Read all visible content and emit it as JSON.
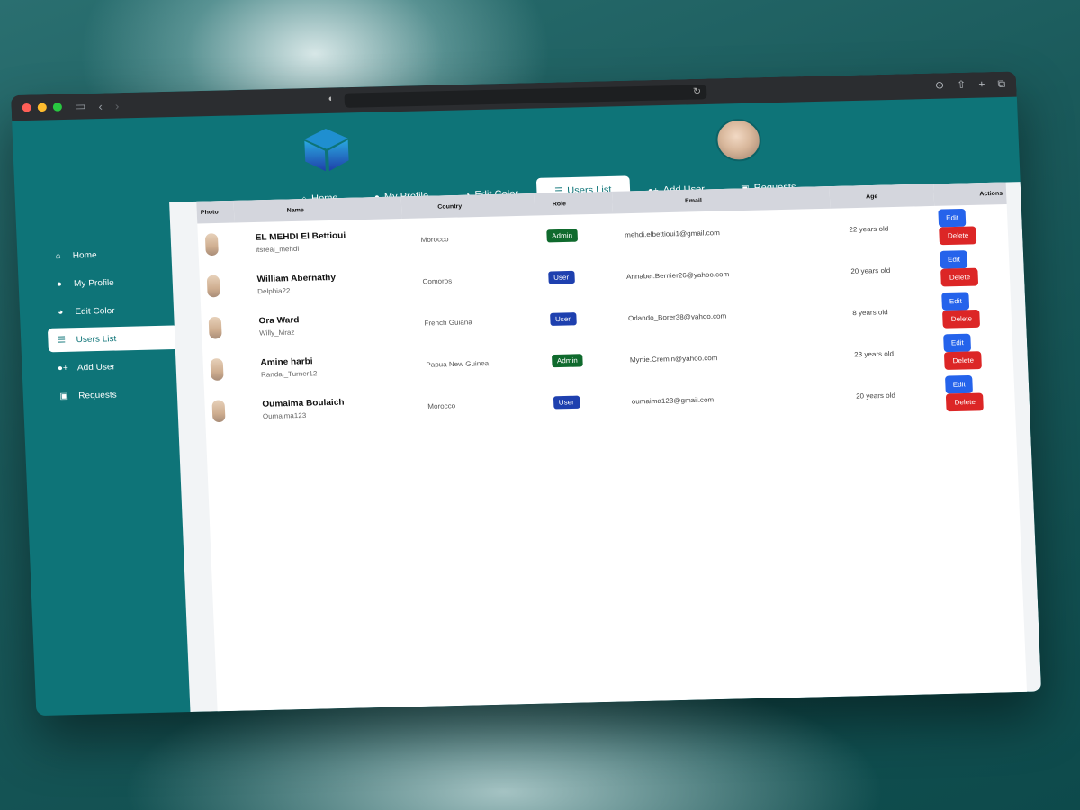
{
  "browser": {
    "icons": [
      "sidebar-toggle-icon",
      "back-icon",
      "forward-icon",
      "shield-icon",
      "reload-icon",
      "download-icon",
      "share-icon",
      "new-tab-icon",
      "tabs-icon"
    ]
  },
  "topnav": [
    {
      "label": "Home",
      "icon": "home-icon"
    },
    {
      "label": "My Profile",
      "icon": "user-icon"
    },
    {
      "label": "Edit Color",
      "icon": "palette-icon"
    },
    {
      "label": "Users List",
      "icon": "list-icon",
      "active": true
    },
    {
      "label": "Add User",
      "icon": "user-plus-icon"
    },
    {
      "label": "Requests",
      "icon": "badge-icon"
    }
  ],
  "sidebar": [
    {
      "label": "Home",
      "icon": "home-icon"
    },
    {
      "label": "My Profile",
      "icon": "user-icon"
    },
    {
      "label": "Edit Color",
      "icon": "palette-icon"
    },
    {
      "label": "Users List",
      "icon": "list-icon",
      "active": true
    },
    {
      "label": "Add User",
      "icon": "user-plus-icon"
    },
    {
      "label": "Requests",
      "icon": "badge-icon"
    }
  ],
  "table": {
    "headers": [
      "Photo",
      "Name",
      "Country",
      "Role",
      "Email",
      "Age",
      "Actions"
    ],
    "rows": [
      {
        "name": "EL MEHDI El Bettioui",
        "username": "itsreal_mehdi",
        "country": "Morocco",
        "role": "Admin",
        "email": "mehdi.elbettioui1@gmail.com",
        "age": "22 years old"
      },
      {
        "name": "William Abernathy",
        "username": "Delphia22",
        "country": "Comoros",
        "role": "User",
        "email": "Annabel.Bernier26@yahoo.com",
        "age": "20 years old"
      },
      {
        "name": "Ora Ward",
        "username": "Willy_Mraz",
        "country": "French Guiana",
        "role": "User",
        "email": "Orlando_Borer38@yahoo.com",
        "age": "8 years old"
      },
      {
        "name": "Amine harbi",
        "username": "Randal_Turner12",
        "country": "Papua New Guinea",
        "role": "Admin",
        "email": "Myrtie.Cremin@yahoo.com",
        "age": "23 years old"
      },
      {
        "name": "Oumaima Boulaich",
        "username": "Oumaima123",
        "country": "Morocco",
        "role": "User",
        "email": "oumaima123@gmail.com",
        "age": "20 years old"
      }
    ],
    "edit_label": "Edit",
    "delete_label": "Delete"
  },
  "colors": {
    "primary": "#0e7478",
    "admin_badge": "#0f6a2d",
    "user_badge": "#1e40af",
    "edit": "#2563eb",
    "delete": "#dc2626"
  }
}
